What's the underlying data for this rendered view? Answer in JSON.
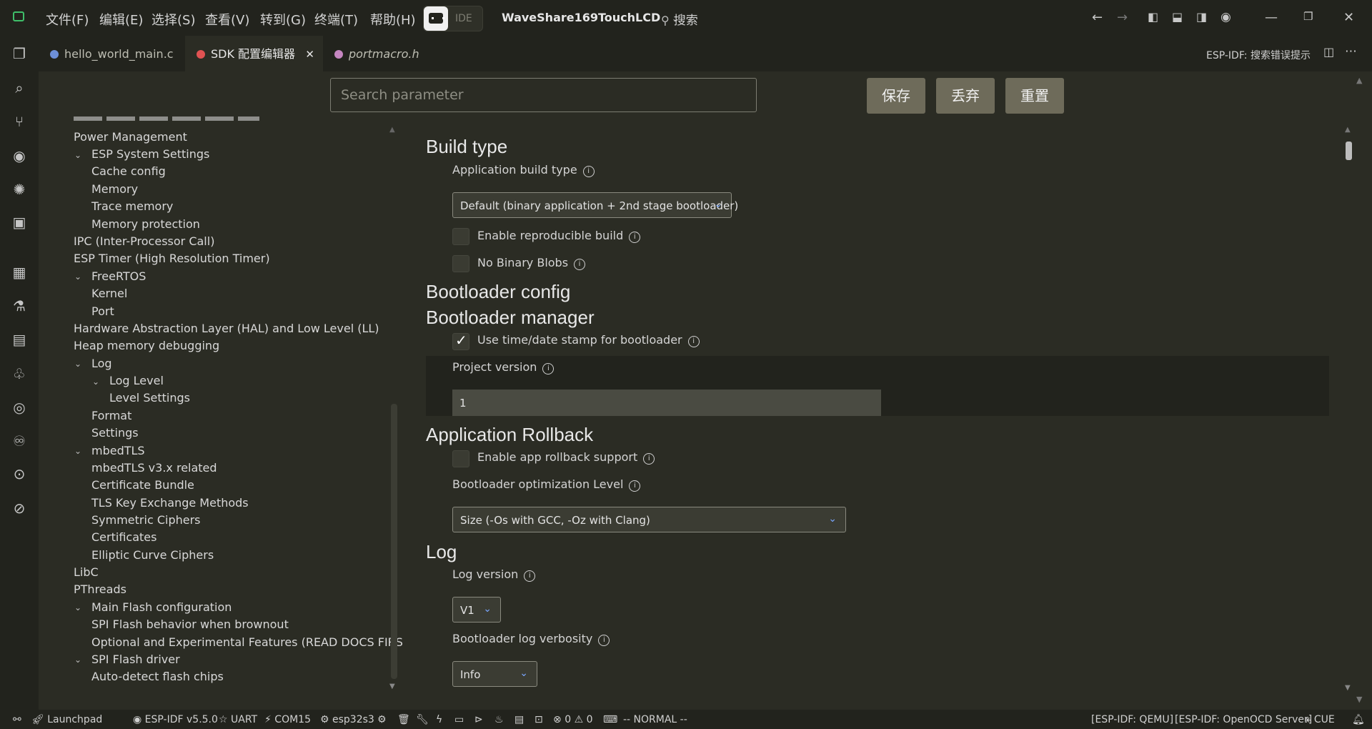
{
  "menu": [
    "文件(F)",
    "编辑(E)",
    "选择(S)",
    "查看(V)",
    "转到(G)",
    "终端(T)",
    "帮助(H)"
  ],
  "ide_label": "IDE",
  "project_name": "WaveShare169TouchLCD",
  "search_label": "搜索",
  "tabs": [
    {
      "label": "hello_world_main.c",
      "icon_color": "#6d8fd8"
    },
    {
      "label": "SDK 配置编辑器",
      "icon_color": "#e05252"
    },
    {
      "label": "portmacro.h",
      "icon_color": "#c586c0"
    }
  ],
  "esp_idf_hint": "ESP-IDF: 搜索错误提示",
  "tree": [
    "Power Management",
    "ESP System Settings",
    "Cache config",
    "Memory",
    "Trace memory",
    "Memory protection",
    "IPC (Inter-Processor Call)",
    "ESP Timer (High Resolution Timer)",
    "FreeRTOS",
    "Kernel",
    "Port",
    "Hardware Abstraction Layer (HAL) and Low Level (LL)",
    "Heap memory debugging",
    "Log",
    "Log Level",
    "Level Settings",
    "Format",
    "Settings",
    "mbedTLS",
    "mbedTLS v3.x related",
    "Certificate Bundle",
    "TLS Key Exchange Methods",
    "Symmetric Ciphers",
    "Certificates",
    "Elliptic Curve Ciphers",
    "LibC",
    "PThreads",
    "Main Flash configuration",
    "SPI Flash behavior when brownout",
    "Optional and Experimental Features (READ DOCS FIRST)",
    "SPI Flash driver",
    "Auto-detect flash chips"
  ],
  "search_placeholder": "Search parameter",
  "buttons": {
    "save": "保存",
    "discard": "丢弃",
    "reset": "重置"
  },
  "sections": {
    "build_type": "Build type",
    "bootloader_config": "Bootloader config",
    "bootloader_manager": "Bootloader manager",
    "app_rollback": "Application Rollback",
    "log": "Log"
  },
  "fields": {
    "app_build_type": "Application build type",
    "app_build_type_value": "Default (binary application + 2nd stage bootloader)",
    "reproducible": "Enable reproducible build",
    "no_binary_blobs": "No Binary Blobs",
    "timestamp": "Use time/date stamp for bootloader",
    "project_version": "Project version",
    "project_version_value": "1",
    "rollback": "Enable app rollback support",
    "opt_level": "Bootloader optimization Level",
    "opt_level_value": "Size (-Os with GCC, -Oz with Clang)",
    "log_version": "Log version",
    "log_version_value": "V1",
    "log_verbosity": "Bootloader log verbosity",
    "log_verbosity_value": "Info"
  },
  "checkbox_state": {
    "reproducible": false,
    "no_binary_blobs": false,
    "timestamp": true,
    "rollback": false
  },
  "status": {
    "launchpad": "Launchpad",
    "idf_version": "ESP-IDF v5.5.0",
    "uart": "UART",
    "port": "COM15",
    "target": "esp32s3",
    "errors": "0",
    "warnings": "0",
    "mode": "-- NORMAL --",
    "qemu": "[ESP-IDF: QEMU]",
    "openocd": "[ESP-IDF: OpenOCD Server]",
    "cue": "CUE"
  },
  "colors": {
    "accent": "#7aa7ff",
    "button_bg": "#6e6b5a",
    "bg": "#2b2c24",
    "bar": "#22231d"
  }
}
